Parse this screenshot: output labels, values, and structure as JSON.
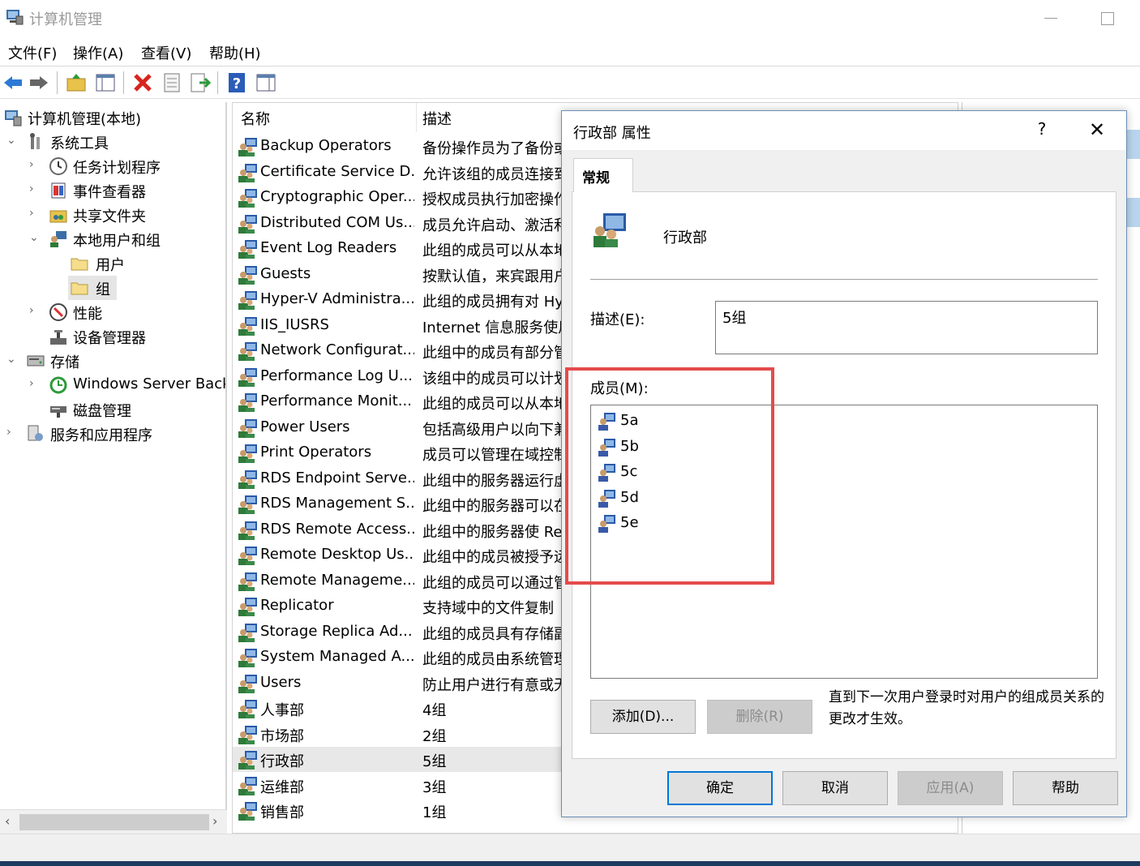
{
  "window": {
    "title": "计算机管理"
  },
  "menu": [
    "文件(F)",
    "操作(A)",
    "查看(V)",
    "帮助(H)"
  ],
  "toolbar_icons": [
    "back-arrow-icon",
    "forward-arrow-icon",
    "up-folder-icon",
    "show-hide-tree-icon",
    "delete-icon",
    "properties-icon",
    "export-icon",
    "help-icon",
    "action-pane-icon"
  ],
  "tree": [
    {
      "label": "计算机管理(本地)",
      "icon": "computer-management-icon"
    },
    {
      "label": "系统工具",
      "icon": "tools-icon",
      "expanded": true
    },
    {
      "label": "任务计划程序",
      "icon": "clock-icon"
    },
    {
      "label": "事件查看器",
      "icon": "event-viewer-icon"
    },
    {
      "label": "共享文件夹",
      "icon": "shared-folder-icon"
    },
    {
      "label": "本地用户和组",
      "icon": "users-icon",
      "expanded": true
    },
    {
      "label": "用户",
      "icon": "folder-icon"
    },
    {
      "label": "组",
      "icon": "folder-icon",
      "selected": true
    },
    {
      "label": "性能",
      "icon": "performance-icon"
    },
    {
      "label": "设备管理器",
      "icon": "device-manager-icon"
    },
    {
      "label": "存储",
      "icon": "storage-icon",
      "expanded": true
    },
    {
      "label": "Windows Server Backup",
      "icon": "backup-icon"
    },
    {
      "label": "磁盘管理",
      "icon": "disk-icon"
    },
    {
      "label": "服务和应用程序",
      "icon": "services-icon"
    }
  ],
  "list": {
    "col_name": "名称",
    "col_desc": "描述",
    "rows": [
      {
        "name": "Backup Operators",
        "desc": "备份操作员为了备份或"
      },
      {
        "name": "Certificate Service D...",
        "desc": "允许该组的成员连接到"
      },
      {
        "name": "Cryptographic Oper...",
        "desc": "授权成员执行加密操作"
      },
      {
        "name": "Distributed COM Us...",
        "desc": "成员允许启动、激活和"
      },
      {
        "name": "Event Log Readers",
        "desc": "此组的成员可以从本地"
      },
      {
        "name": "Guests",
        "desc": "按默认值，来宾跟用户"
      },
      {
        "name": "Hyper-V Administra...",
        "desc": "此组的成员拥有对 Hy"
      },
      {
        "name": "IIS_IUSRS",
        "desc": "Internet 信息服务使用"
      },
      {
        "name": "Network Configurat...",
        "desc": "此组中的成员有部分管"
      },
      {
        "name": "Performance Log U...",
        "desc": "该组中的成员可以计划"
      },
      {
        "name": "Performance Monit...",
        "desc": "此组的成员可以从本地"
      },
      {
        "name": "Power Users",
        "desc": "包括高级用户以向下兼"
      },
      {
        "name": "Print Operators",
        "desc": "成员可以管理在域控制"
      },
      {
        "name": "RDS Endpoint Serve...",
        "desc": "此组中的服务器运行虚"
      },
      {
        "name": "RDS Management S...",
        "desc": "此组中的服务器可以在"
      },
      {
        "name": "RDS Remote Access...",
        "desc": "此组中的服务器使 Re"
      },
      {
        "name": "Remote Desktop Us...",
        "desc": "此组中的成员被授予远"
      },
      {
        "name": "Remote Manageme...",
        "desc": "此组的成员可以通过管"
      },
      {
        "name": "Replicator",
        "desc": "支持域中的文件复制"
      },
      {
        "name": "Storage Replica Ad...",
        "desc": "此组的成员具有存储副"
      },
      {
        "name": "System Managed A...",
        "desc": "此组的成员由系统管理"
      },
      {
        "name": "Users",
        "desc": "防止用户进行有意或无"
      },
      {
        "name": "人事部",
        "desc": "4组"
      },
      {
        "name": "市场部",
        "desc": "2组"
      },
      {
        "name": "行政部",
        "desc": "5组",
        "selected": true
      },
      {
        "name": "运维部",
        "desc": "3组"
      },
      {
        "name": "销售部",
        "desc": "1组"
      }
    ]
  },
  "dialog": {
    "title": "行政部 属性",
    "help": "?",
    "close": "✕",
    "tab": "常规",
    "group_name": "行政部",
    "desc_label": "描述(E):",
    "desc_value": "5组",
    "members_label": "成员(M):",
    "members": [
      "5a",
      "5b",
      "5c",
      "5d",
      "5e"
    ],
    "add_button": "添加(D)...",
    "remove_button": "删除(R)",
    "note": "直到下一次用户登录时对用户的组成员关系的更改才生效。",
    "ok_button": "确定",
    "cancel_button": "取消",
    "apply_button": "应用(A)",
    "help_button": "帮助"
  },
  "colors": {
    "highlight": "#e54b4b",
    "accent": "#0078d7"
  }
}
